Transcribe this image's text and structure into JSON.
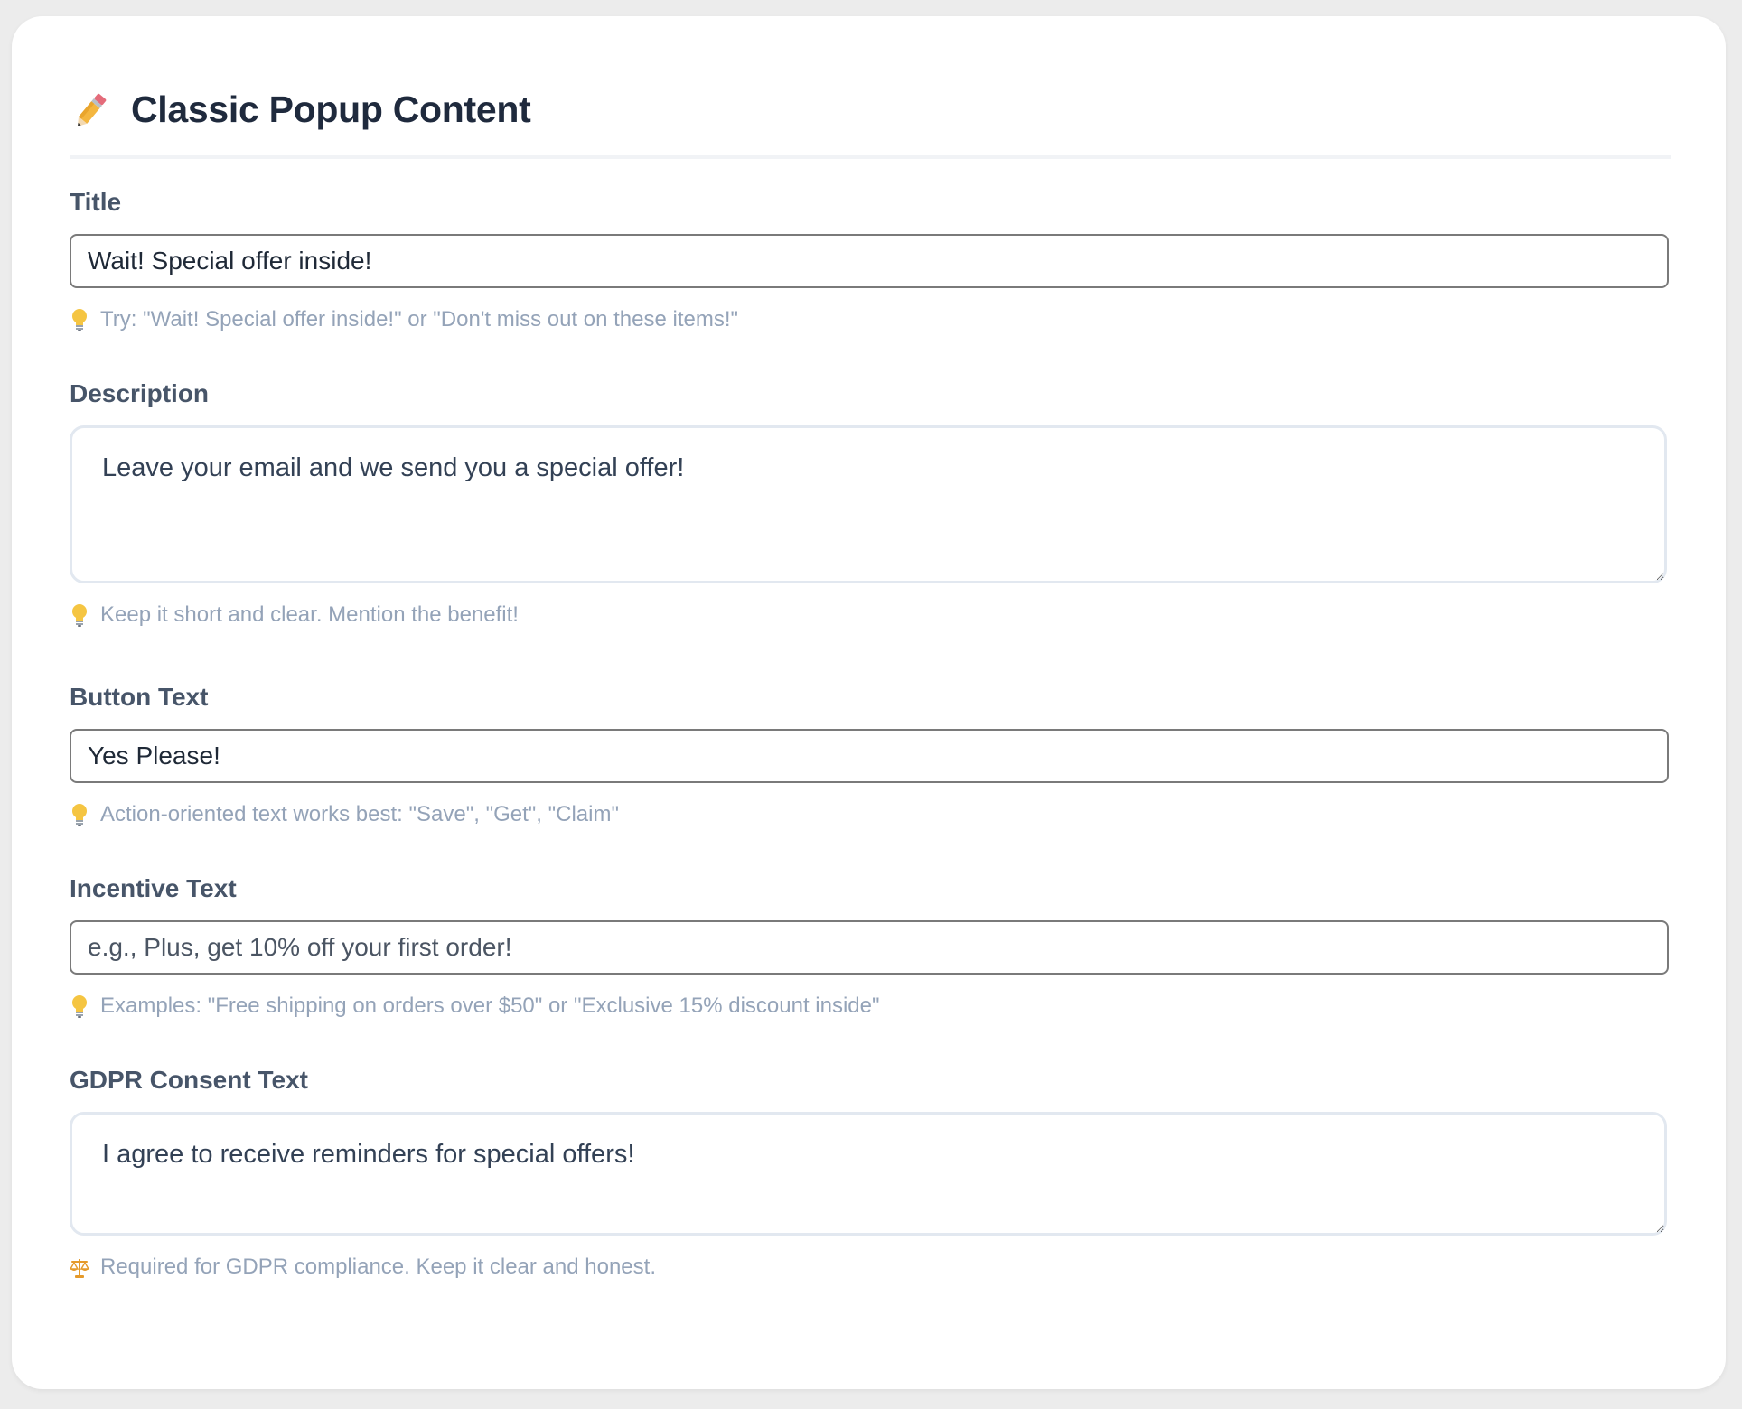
{
  "header": {
    "icon": "pencil-icon",
    "title": "Classic Popup Content"
  },
  "fields": {
    "title": {
      "label": "Title",
      "value": "Wait! Special offer inside!",
      "placeholder": "",
      "hint_icon": "lightbulb-icon",
      "hint": "Try: \"Wait! Special offer inside!\" or \"Don't miss out on these items!\""
    },
    "description": {
      "label": "Description",
      "value": "Leave your email and we send you a special offer!",
      "hint_icon": "lightbulb-icon",
      "hint": "Keep it short and clear. Mention the benefit!"
    },
    "button_text": {
      "label": "Button Text",
      "value": "Yes Please!",
      "placeholder": "",
      "hint_icon": "lightbulb-icon",
      "hint": "Action-oriented text works best: \"Save\", \"Get\", \"Claim\""
    },
    "incentive_text": {
      "label": "Incentive Text",
      "value": "",
      "placeholder": "e.g., Plus, get 10% off your first order!",
      "hint_icon": "lightbulb-icon",
      "hint": "Examples: \"Free shipping on orders over $50\" or \"Exclusive 15% discount inside\""
    },
    "gdpr_consent": {
      "label": "GDPR Consent Text",
      "value": "I agree to receive reminders for special offers!",
      "hint_icon": "scales-icon",
      "hint": "Required for GDPR compliance. Keep it clear and honest."
    }
  },
  "colors": {
    "page_bg": "#ececec",
    "card_bg": "#ffffff",
    "title": "#1f2a3d",
    "label": "#475569",
    "hint": "#94a3b8",
    "lightbulb": "#f5c542",
    "scales": "#e59a2b"
  }
}
